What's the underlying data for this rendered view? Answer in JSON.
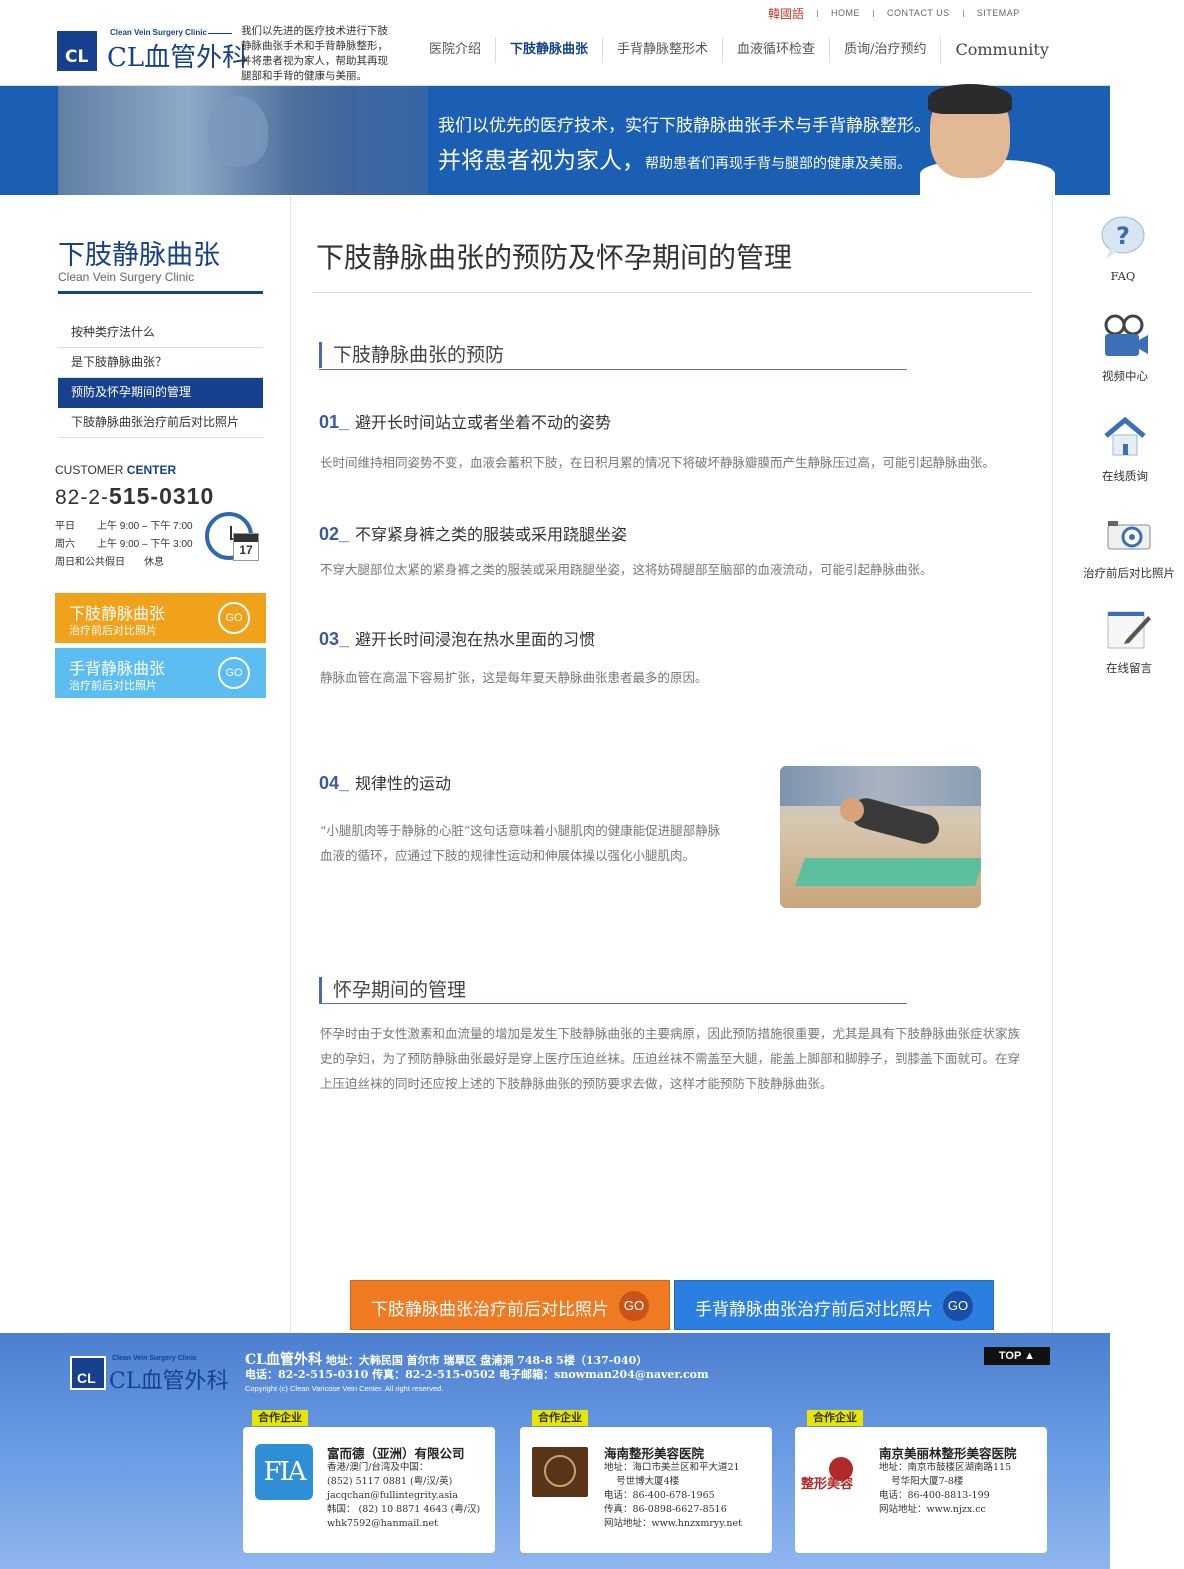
{
  "header": {
    "logo_small": "Clean Vein Surgery Clinic",
    "logo_cl": "CL",
    "logo_name": "CL血管外科",
    "slogan": "我们以先进的医疗技术进行下肢静脉曲张手术和手背静脉整形，并将患者视为家人，帮助其再现腿部和手背的健康与美丽。",
    "top_links": [
      "韓國語",
      "HOME",
      "CONTACT US",
      "SITEMAP"
    ],
    "nav": [
      {
        "label": "医院介绍",
        "active": false
      },
      {
        "label": "下肢静脉曲张",
        "active": true
      },
      {
        "label": "手背静脉整形术",
        "active": false
      },
      {
        "label": "血液循环检查",
        "active": false
      },
      {
        "label": "质询/治疗预约",
        "active": false
      },
      {
        "label": "Community",
        "active": false
      }
    ]
  },
  "banner": {
    "line1": "我们以优先的医疗技术，实行下肢静脉曲张手术与手背静脉整形。",
    "line2_big": "并将患者视为家人，",
    "line2_small": "帮助患者们再现手背与腿部的健康及美丽。"
  },
  "sidebar": {
    "title": "下肢静脉曲张",
    "subtitle": "Clean Vein Surgery Clinic",
    "menu": [
      {
        "label": "按种类疗法什么",
        "active": false
      },
      {
        "label": "是下肢静脉曲张？",
        "active": false
      },
      {
        "label": "预防及怀孕期间的管理",
        "active": true
      },
      {
        "label": "下肢静脉曲张治疗前后对比照片",
        "active": false
      }
    ],
    "customer_center": {
      "title_a": "CUSTOMER",
      "title_b": "CENTER",
      "phone_prefix": "82-2-",
      "phone_main": "515-0310",
      "rows": [
        {
          "day": "平日",
          "time": "上午 9:00 – 下午 7:00"
        },
        {
          "day": "周六",
          "time": "上午 9:00 – 下午 3:00"
        },
        {
          "day": "周日和公共假日",
          "time": "休息"
        }
      ],
      "calendar_day": "17"
    },
    "quick_buttons": [
      {
        "title": "下肢静脉曲张",
        "sub": "治疗前后对比照片",
        "go": "GO",
        "color": "#f0a21a"
      },
      {
        "title": "手背静脉曲张",
        "sub": "治疗前后对比照片",
        "go": "GO",
        "color": "#5bbdf0"
      }
    ]
  },
  "main": {
    "page_title": "下肢静脉曲张的预防及怀孕期间的管理",
    "section1_title": "下肢静脉曲张的预防",
    "items": [
      {
        "num": "01_",
        "title": "避开长时间站立或者坐着不动的姿势",
        "text": "长时间维持相同姿势不变，血液会蓄积下肢，在日积月累的情况下将破坏静脉瓣膜而产生静脉压过高，可能引起静脉曲张。"
      },
      {
        "num": "02_",
        "title": "不穿紧身裤之类的服装或采用跷腿坐姿",
        "text": "不穿大腿部位太紧的紧身裤之类的服装或采用跷腿坐姿，这将妨碍腿部至脑部的血液流动，可能引起静脉曲张。"
      },
      {
        "num": "03_",
        "title": "避开长时间浸泡在热水里面的习惯",
        "text": "静脉血管在高温下容易扩张，这是每年夏天静脉曲张患者最多的原因。"
      },
      {
        "num": "04_",
        "title": "规律性的运动",
        "text": "“小腿肌肉等于静脉的心脏”这句话意味着小腿肌肉的健康能促进腿部静脉血液的循环，应通过下肢的规律性运动和伸展体操以强化小腿肌肉。"
      }
    ],
    "section2_title": "怀孕期间的管理",
    "section2_text": "怀孕时由于女性激素和血流量的增加是发生下肢静脉曲张的主要病原，因此预防措施很重要，尤其是具有下肢静脉曲张症状家族史的孕妇，为了预防静脉曲张最好是穿上医疗压迫丝袜。压迫丝袜不需盖至大腿，能盖上脚部和脚脖子，到膝盖下面就可。在穿上压迫丝袜的同时还应按上述的下肢静脉曲张的预防要求去做，这样才能预防下肢静脉曲张。",
    "bottom_buttons": [
      {
        "label": "下肢静脉曲张治疗前后对比照片",
        "go": "GO",
        "color": "#f07a22"
      },
      {
        "label": "手背静脉曲张治疗前后对比照片",
        "go": "GO",
        "color": "#2a7fe0"
      }
    ]
  },
  "quick_menu": [
    {
      "label": "FAQ",
      "icon": "question-icon"
    },
    {
      "label": "视频中心",
      "icon": "video-camera-icon"
    },
    {
      "label": "在线质询",
      "icon": "house-icon"
    },
    {
      "label": "治疗前后对比照片",
      "icon": "camera-icon"
    },
    {
      "label": "在线留言",
      "icon": "note-pen-icon"
    }
  ],
  "footer": {
    "logo_small": "Clean Vein Surgery Clinic",
    "logo_cl": "CL",
    "logo_name": "CL血管外科",
    "name": "CL血管外科",
    "address": "地址：大韩民国 首尔市 瑞草区 盘浦洞 748-8 5楼（137-040）",
    "contact": "电话：82-2-515-0310  传真：82-2-515-0502  电子邮箱：snowman204@naver.com",
    "copyright": "Copyright (c) Clean Varicose Vein Center. All right reserved.",
    "top_button": "TOP ▲",
    "partner_tag": "合作企业",
    "partners": [
      {
        "logo": "FIA",
        "name": "富而德（亚洲）有限公司",
        "lines": [
          "香港/澳门/台湾及中国：",
          "(852) 5117 0881 (粤/汉/英)",
          "jacqchan@fullintegrity.asia",
          "韩国： (82) 10 8871 4643 (粤/汉)",
          "whk7592@hanmail.net"
        ]
      },
      {
        "logo": "",
        "name": "海南整形美容医院",
        "lines": [
          "地址：海口市美兰区和平大道21",
          "    号世博大厦4楼",
          "电话：86-400-678-1965",
          "传真：86-0898-6627-8516",
          "网站地址：www.hnzxmryy.net"
        ]
      },
      {
        "logo": "整形美容",
        "name": "南京美丽林整形美容医院",
        "lines": [
          "地址：南京市鼓楼区湖南路115",
          "    号华阳大厦7-8楼",
          "电话：86-400-8813-199",
          "网站地址：www.njzx.cc"
        ]
      }
    ]
  }
}
